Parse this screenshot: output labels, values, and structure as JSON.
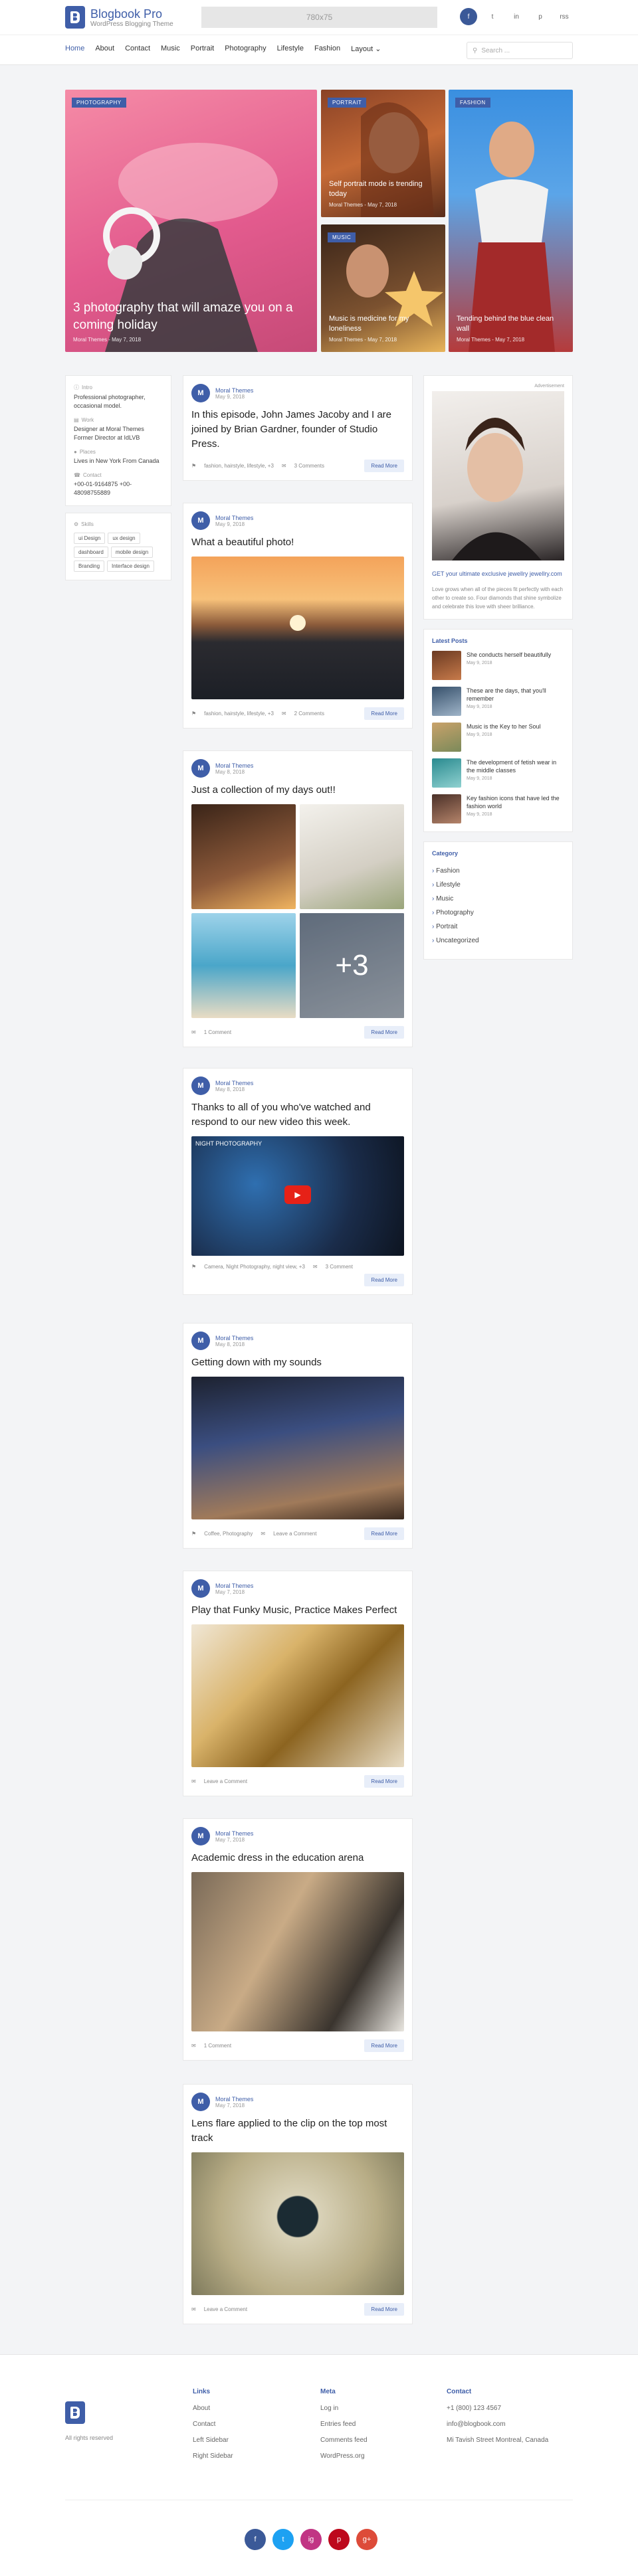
{
  "header": {
    "brand_title": "Blogbook Pro",
    "brand_tagline": "WordPress Blogging Theme",
    "ad_text": "780x75",
    "social": [
      "f",
      "t",
      "in",
      "p",
      "rss"
    ]
  },
  "nav": {
    "items": [
      "Home",
      "About",
      "Contact",
      "Music",
      "Portrait",
      "Photography",
      "Lifestyle",
      "Fashion",
      "Layout"
    ],
    "search_placeholder": "Search ..."
  },
  "hero": [
    {
      "category": "Photography",
      "title": "3 photography that will amaze you on a coming holiday",
      "meta": "Moral Themes - May 7, 2018"
    },
    {
      "category": "Portrait",
      "title": "Self portrait mode is trending today",
      "meta": "Moral Themes - May 7, 2018"
    },
    {
      "category": "Music",
      "title": "Music is medicine for my loneliness",
      "meta": "Moral Themes - May 7, 2018"
    },
    {
      "category": "Fashion",
      "title": "Tending behind the blue clean wall",
      "meta": "Moral Themes - May 7, 2018"
    }
  ],
  "about": {
    "items": [
      {
        "label": "Intro",
        "value": "Professional photographer, occasional model."
      },
      {
        "label": "Work",
        "value": "Designer at Moral Themes Former Director at IdLVB"
      },
      {
        "label": "Places",
        "value": "Lives in New York From Canada"
      },
      {
        "label": "Contact",
        "value": "+00-01-9164875 +00-48098755889"
      }
    ],
    "skills_label": "Skills",
    "skills": [
      "ui Design",
      "ux design",
      "dashboard",
      "mobile design",
      "Branding",
      "Interface design"
    ]
  },
  "posts": [
    {
      "author": "Moral Themes",
      "date": "May 9, 2018",
      "title": "In this episode, John James Jacoby and I are joined by Brian Gardner, founder of Studio Press.",
      "tags": "fashion, hairstyle, lifestyle, +3",
      "comments": "3 Comments",
      "read": "Read More"
    },
    {
      "author": "Moral Themes",
      "date": "May 9, 2018",
      "title": "What a beautiful photo!",
      "tags": "fashion, hairstyle, lifestyle, +3",
      "comments": "2 Comments",
      "read": "Read More"
    },
    {
      "author": "Moral Themes",
      "date": "May 8, 2018",
      "title": "Just a collection of my days out!!",
      "tags": "",
      "comments": "1 Comment",
      "read": "Read More",
      "more_count": "+3"
    },
    {
      "author": "Moral Themes",
      "date": "May 8, 2018",
      "title": "Thanks to all of you who've watched and respond to our new video this week.",
      "tags": "Camera, Night Photography, night view, +3",
      "comments": "3 Comment",
      "read": "Read More",
      "video_title": "NIGHT PHOTOGRAPHY"
    },
    {
      "author": "Moral Themes",
      "date": "May 8, 2018",
      "title": "Getting down with my sounds",
      "tags": "Coffee, Photography",
      "comments": "Leave a Comment",
      "read": "Read More"
    },
    {
      "author": "Moral Themes",
      "date": "May 7, 2018",
      "title": "Play that Funky Music, Practice Makes Perfect",
      "tags": "",
      "comments": "Leave a Comment",
      "read": "Read More"
    },
    {
      "author": "Moral Themes",
      "date": "May 7, 2018",
      "title": "Academic dress in the education arena",
      "tags": "",
      "comments": "1 Comment",
      "read": "Read More"
    },
    {
      "author": "Moral Themes",
      "date": "May 7, 2018",
      "title": "Lens flare applied to the clip on the top most track",
      "tags": "",
      "comments": "Leave a Comment",
      "read": "Read More"
    }
  ],
  "sidebar": {
    "ad_label": "Advertisement",
    "ad_title": "GET your ultimate exclusive jewellry jewellry.com",
    "ad_text": "Love grows when all of the pieces fit perfectly with each other to create so. Four diamonds that shine symbolize and celebrate this love with sheer brilliance.",
    "latest_title": "Latest Posts",
    "latest": [
      {
        "title": "She conducts herself beautifully",
        "date": "May 9, 2018"
      },
      {
        "title": "These are the days, that you'll remember",
        "date": "May 9, 2018"
      },
      {
        "title": "Music is the Key to her Soul",
        "date": "May 9, 2018"
      },
      {
        "title": "The development of fetish wear in the middle classes",
        "date": "May 9, 2018"
      },
      {
        "title": "Key fashion icons that have led the fashion world",
        "date": "May 9, 2018"
      }
    ],
    "category_title": "Category",
    "categories": [
      "Fashion",
      "Lifestyle",
      "Music",
      "Photography",
      "Portrait",
      "Uncategorized"
    ]
  },
  "footer": {
    "rights": "All rights reserved",
    "links_title": "Links",
    "links": [
      "About",
      "Contact",
      "Left Sidebar",
      "Right Sidebar"
    ],
    "meta_title": "Meta",
    "meta": [
      "Log in",
      "Entries feed",
      "Comments feed",
      "WordPress.org"
    ],
    "contact_title": "Contact",
    "contact": [
      "+1 (800) 123 4567",
      "info@blogbook.com",
      "Mi Tavish Street Montreal, Canada"
    ],
    "social": [
      "f",
      "t",
      "ig",
      "p",
      "g+"
    ]
  },
  "colors": {
    "accent": "#3f5ea8",
    "bg": "#f3f4f6"
  }
}
